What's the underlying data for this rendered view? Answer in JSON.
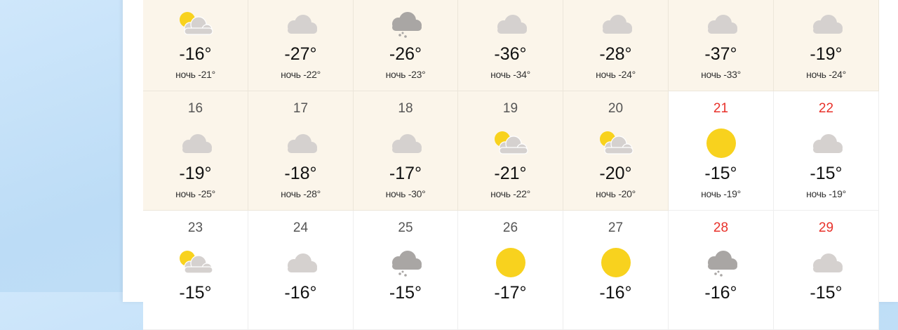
{
  "colors": {
    "past_bg": "#fbf5ea",
    "future_bg": "#ffffff",
    "weekend_day": "#e8312a",
    "sun": "#f8d21e",
    "cloud": "#d5d1cf",
    "storm_cloud": "#a9a6a4"
  },
  "weeks": [
    {
      "days": [
        {
          "day": "",
          "weekend": false,
          "past": true,
          "icon": "sun-cloud-icon",
          "temp": "-16°",
          "night": "ночь -21°"
        },
        {
          "day": "",
          "weekend": false,
          "past": true,
          "icon": "cloud-icon",
          "temp": "-27°",
          "night": "ночь -22°"
        },
        {
          "day": "",
          "weekend": false,
          "past": true,
          "icon": "snow-cloud-icon",
          "temp": "-26°",
          "night": "ночь -23°"
        },
        {
          "day": "",
          "weekend": false,
          "past": true,
          "icon": "cloud-icon",
          "temp": "-36°",
          "night": "ночь -34°"
        },
        {
          "day": "",
          "weekend": false,
          "past": true,
          "icon": "cloud-icon",
          "temp": "-28°",
          "night": "ночь -24°"
        },
        {
          "day": "",
          "weekend": false,
          "past": true,
          "icon": "cloud-icon",
          "temp": "-37°",
          "night": "ночь -33°"
        },
        {
          "day": "",
          "weekend": false,
          "past": true,
          "icon": "cloud-icon",
          "temp": "-19°",
          "night": "ночь -24°"
        }
      ]
    },
    {
      "days": [
        {
          "day": "16",
          "weekend": false,
          "past": true,
          "icon": "cloud-icon",
          "temp": "-19°",
          "night": "ночь -25°"
        },
        {
          "day": "17",
          "weekend": false,
          "past": true,
          "icon": "cloud-icon",
          "temp": "-18°",
          "night": "ночь -28°"
        },
        {
          "day": "18",
          "weekend": false,
          "past": true,
          "icon": "cloud-icon",
          "temp": "-17°",
          "night": "ночь -30°"
        },
        {
          "day": "19",
          "weekend": false,
          "past": true,
          "icon": "sun-cloud-icon",
          "temp": "-21°",
          "night": "ночь -22°"
        },
        {
          "day": "20",
          "weekend": false,
          "past": true,
          "icon": "sun-cloud-icon",
          "temp": "-20°",
          "night": "ночь -20°"
        },
        {
          "day": "21",
          "weekend": true,
          "past": false,
          "icon": "sun-icon",
          "temp": "-15°",
          "night": "ночь -19°"
        },
        {
          "day": "22",
          "weekend": true,
          "past": false,
          "icon": "cloud-icon",
          "temp": "-15°",
          "night": "ночь -19°"
        }
      ]
    },
    {
      "days": [
        {
          "day": "23",
          "weekend": false,
          "past": false,
          "icon": "sun-cloud-icon",
          "temp": "-15°",
          "night": ""
        },
        {
          "day": "24",
          "weekend": false,
          "past": false,
          "icon": "cloud-icon",
          "temp": "-16°",
          "night": ""
        },
        {
          "day": "25",
          "weekend": false,
          "past": false,
          "icon": "snow-cloud-icon",
          "temp": "-15°",
          "night": ""
        },
        {
          "day": "26",
          "weekend": false,
          "past": false,
          "icon": "sun-icon",
          "temp": "-17°",
          "night": ""
        },
        {
          "day": "27",
          "weekend": false,
          "past": false,
          "icon": "sun-icon",
          "temp": "-16°",
          "night": ""
        },
        {
          "day": "28",
          "weekend": true,
          "past": false,
          "icon": "snow-cloud-icon",
          "temp": "-16°",
          "night": ""
        },
        {
          "day": "29",
          "weekend": true,
          "past": false,
          "icon": "cloud-icon",
          "temp": "-15°",
          "night": ""
        }
      ]
    }
  ]
}
